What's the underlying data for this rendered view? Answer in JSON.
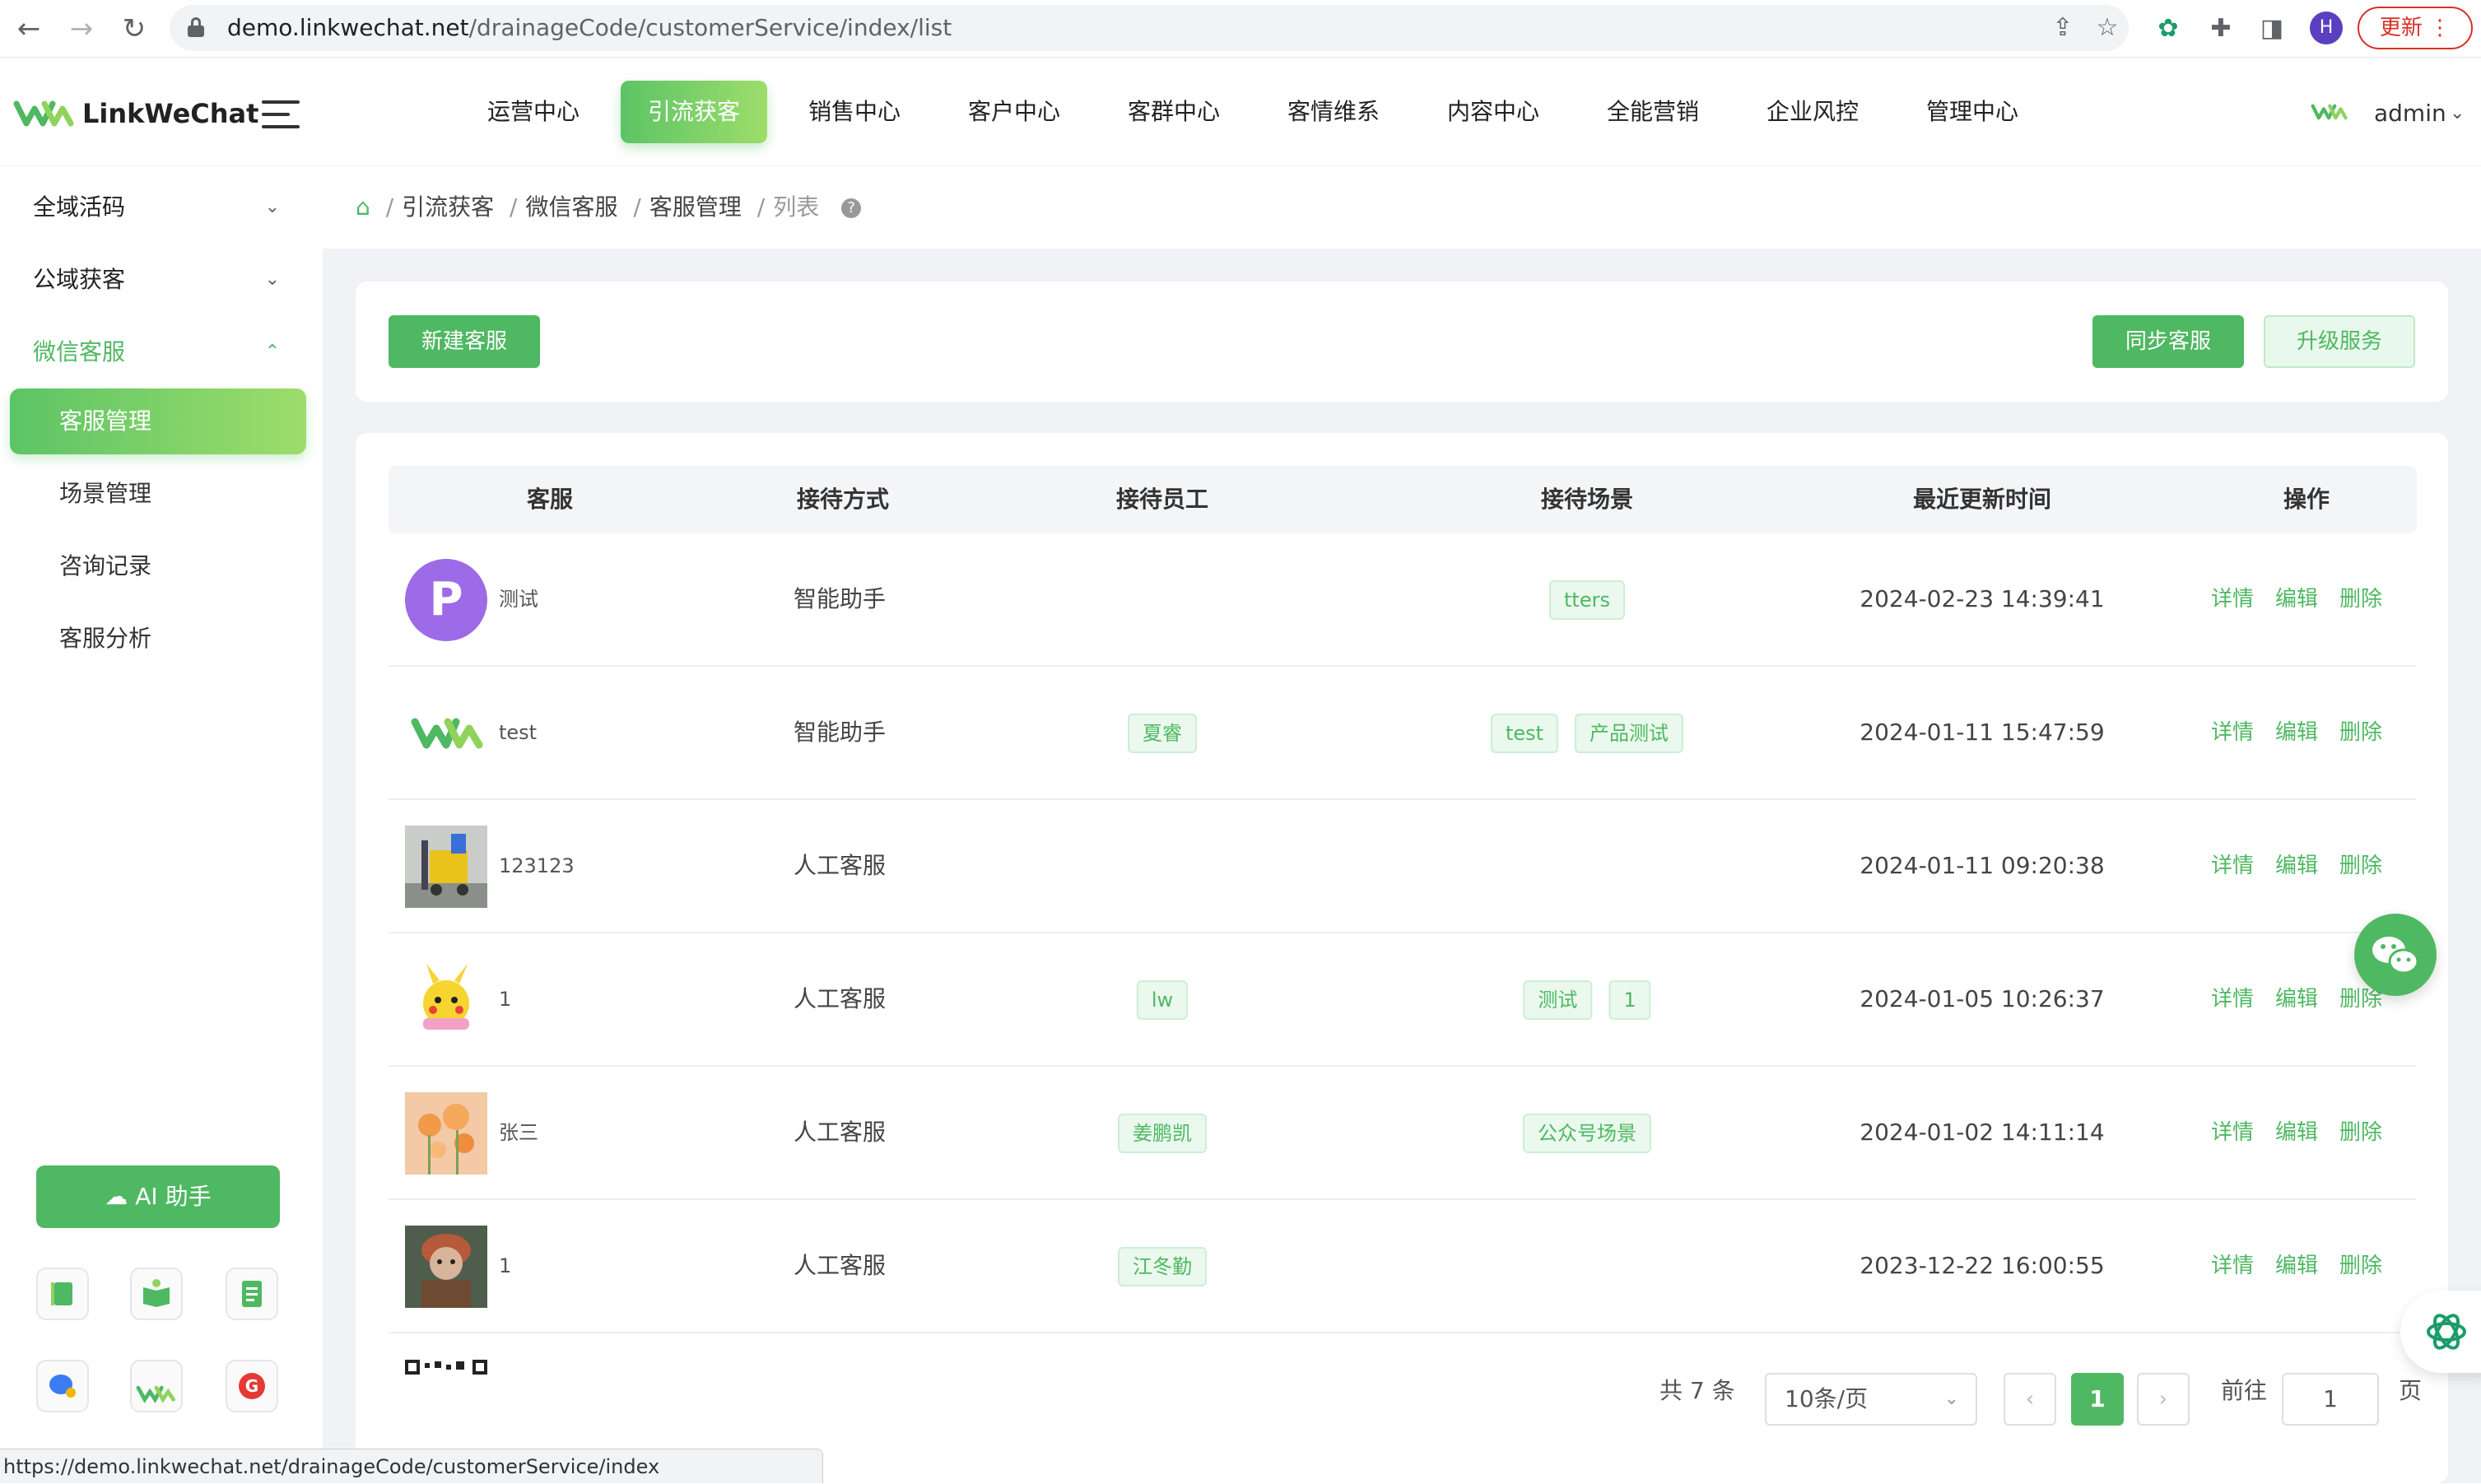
{
  "browser": {
    "url_host": "demo.linkwechat.net",
    "url_path": "/drainageCode/customerService/index/list",
    "profile_initial": "H",
    "update_label": "更新",
    "status_url": "https://demo.linkwechat.net/drainageCode/customerService/index"
  },
  "app": {
    "logo_text": "LinkWeChat",
    "brand_color": "#4fb862",
    "user_name": "admin"
  },
  "topnav": [
    {
      "label": "运营中心",
      "active": false
    },
    {
      "label": "引流获客",
      "active": true
    },
    {
      "label": "销售中心",
      "active": false
    },
    {
      "label": "客户中心",
      "active": false
    },
    {
      "label": "客群中心",
      "active": false
    },
    {
      "label": "客情维系",
      "active": false
    },
    {
      "label": "内容中心",
      "active": false
    },
    {
      "label": "全能营销",
      "active": false
    },
    {
      "label": "企业风控",
      "active": false
    },
    {
      "label": "管理中心",
      "active": false
    }
  ],
  "sidebar": {
    "groups": [
      {
        "label": "全域活码",
        "expanded": false
      },
      {
        "label": "公域获客",
        "expanded": false
      },
      {
        "label": "微信客服",
        "expanded": true
      }
    ],
    "items": [
      {
        "label": "客服管理",
        "active": true
      },
      {
        "label": "场景管理",
        "active": false
      },
      {
        "label": "咨询记录",
        "active": false
      },
      {
        "label": "客服分析",
        "active": false
      }
    ],
    "ai_button": "AI 助手"
  },
  "breadcrumb": [
    "引流获客",
    "微信客服",
    "客服管理",
    "列表"
  ],
  "toolbar": {
    "new_label": "新建客服",
    "sync_label": "同步客服",
    "upgrade_label": "升级服务"
  },
  "table": {
    "columns": [
      "客服",
      "接待方式",
      "接待员工",
      "接待场景",
      "最近更新时间",
      "操作"
    ],
    "actions": [
      "详情",
      "编辑",
      "删除"
    ],
    "rows": [
      {
        "name": "测试",
        "avatar": "letter-p",
        "mode": "智能助手",
        "staff": [],
        "scenes": [
          "tters"
        ],
        "updated": "2024-02-23 14:39:41"
      },
      {
        "name": "test",
        "avatar": "logo",
        "mode": "智能助手",
        "staff": [
          "夏睿"
        ],
        "scenes": [
          "test",
          "产品测试"
        ],
        "updated": "2024-01-11 15:47:59"
      },
      {
        "name": "123123",
        "avatar": "photo-cart",
        "mode": "人工客服",
        "staff": [],
        "scenes": [],
        "updated": "2024-01-11 09:20:38"
      },
      {
        "name": "1",
        "avatar": "photo-pikachu",
        "mode": "人工客服",
        "staff": [
          "lw"
        ],
        "scenes": [
          "测试",
          "1"
        ],
        "updated": "2024-01-05 10:26:37"
      },
      {
        "name": "张三",
        "avatar": "photo-flowers",
        "mode": "人工客服",
        "staff": [
          "姜鹏凯"
        ],
        "scenes": [
          "公众号场景"
        ],
        "updated": "2024-01-02 14:11:14"
      },
      {
        "name": "1",
        "avatar": "photo-figure",
        "mode": "人工客服",
        "staff": [
          "江冬勤"
        ],
        "scenes": [],
        "updated": "2023-12-22 16:00:55"
      }
    ]
  },
  "pagination": {
    "total_label": "共 7 条",
    "page_size": "10条/页",
    "current_page": "1",
    "goto_label": "前往",
    "goto_value": "1",
    "page_suffix": "页"
  }
}
